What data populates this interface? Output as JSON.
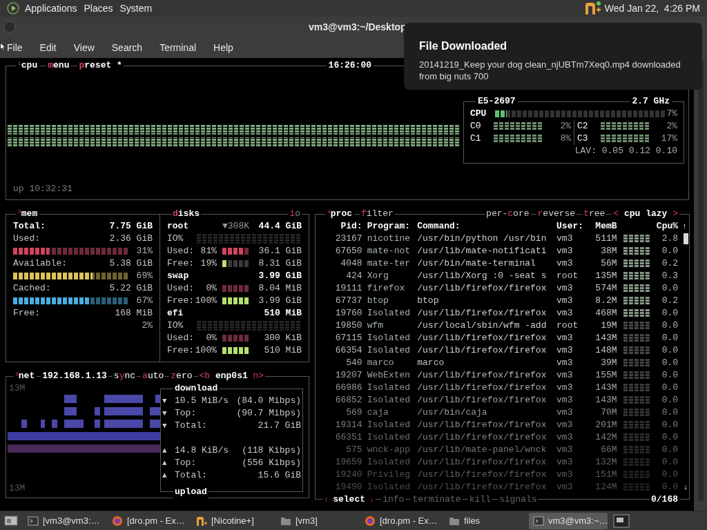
{
  "top_panel": {
    "menus": [
      "Applications",
      "Places",
      "System"
    ],
    "clock": "Wed Jan 22,  4:26 PM"
  },
  "window": {
    "title": "vm3@vm3:~/Desktop",
    "menu": [
      "File",
      "Edit",
      "View",
      "Search",
      "Terminal",
      "Help"
    ]
  },
  "notification": {
    "title": "File Downloaded",
    "body": "20141219_Keep your dog clean_njUBTm7Xeq0.mp4 downloaded from big nuts 700"
  },
  "cpu": {
    "number": "1",
    "title": "cpu",
    "buttons": [
      {
        "key": "m",
        "after": "enu"
      },
      {
        "key": "p",
        "after": "reset *"
      }
    ],
    "clock": "16:26:00",
    "uptime": "up 10:32:31",
    "model": "E5-2697",
    "freq": "2.7 GHz",
    "total": {
      "label": "CPU",
      "level": 0.07,
      "value": "7%"
    },
    "cores": [
      {
        "label": "C0",
        "value": "2%"
      },
      {
        "label": "C2",
        "value": "2%"
      },
      {
        "label": "C1",
        "value": "8%"
      },
      {
        "label": "C3",
        "value": "17%"
      }
    ],
    "load": "LAV: 0.05 0.12 0.10"
  },
  "mem": {
    "number": "2",
    "title": "mem",
    "rows": [
      {
        "kind": "heading",
        "label": "Total:",
        "value": "7.75 GiB"
      },
      {
        "kind": "line",
        "label": "Used:",
        "value": "2.36 GiB"
      },
      {
        "kind": "meter",
        "level": 0.31,
        "value": "31%"
      },
      {
        "kind": "line",
        "label": "Available:",
        "value": "5.38 GiB"
      },
      {
        "kind": "meter",
        "level": 0.69,
        "value": "69%"
      },
      {
        "kind": "line",
        "label": "Cached:",
        "value": "5.22 GiB"
      },
      {
        "kind": "meter",
        "level": 0.67,
        "value": "67%"
      },
      {
        "kind": "line",
        "label": "Free:",
        "value": "168 MiB"
      },
      {
        "kind": "percent",
        "value": "2%"
      }
    ]
  },
  "disks": {
    "title": {
      "key": "d",
      "after": "isks"
    },
    "io_button": {
      "key": "i",
      "after": "o"
    },
    "items": [
      {
        "name": "root",
        "io": "▼308K",
        "size": "44.4 GiB",
        "rows": [
          {
            "kind": "io",
            "label": "IO%"
          },
          {
            "kind": "meter",
            "label": "Used:",
            "pct": "81%",
            "level": 0.81,
            "value": "36.1 GiB"
          },
          {
            "kind": "meter",
            "label": "Free:",
            "pct": "19%",
            "level": 0.19,
            "value": "8.31 GiB"
          }
        ]
      },
      {
        "name": "swap",
        "size": "3.99 GiB",
        "rows": [
          {
            "kind": "meter",
            "label": "Used:",
            "pct": "0%",
            "level": 0,
            "value": "8.04 MiB"
          },
          {
            "kind": "meter",
            "label": "Free:",
            "pct": "100%",
            "level": 1,
            "value": "3.99 GiB"
          }
        ]
      },
      {
        "name": "efi",
        "size": "510 MiB",
        "rows": [
          {
            "kind": "io",
            "label": "IO%"
          },
          {
            "kind": "meter",
            "label": "Used:",
            "pct": "0%",
            "level": 0,
            "value": "300 KiB"
          },
          {
            "kind": "meter",
            "label": "Free:",
            "pct": "100%",
            "level": 1,
            "value": "510 MiB"
          }
        ]
      }
    ]
  },
  "net": {
    "number": "3",
    "title": "net",
    "ip": "192.168.1.13",
    "buttons": [
      {
        "before": "s",
        "key": "y",
        "after": "nc"
      },
      {
        "key": "a",
        "after": "uto"
      },
      {
        "key": "z",
        "after": "ero"
      }
    ],
    "iface": {
      "prev": "<b",
      "name": "enp0s1",
      "next": "n>"
    },
    "scale_top": "13M",
    "scale_bottom": "13M",
    "download": {
      "title": "download",
      "rows": [
        {
          "arrow": "▼",
          "label": "10.5 MiB/s",
          "value": "(84.0 Mibps)"
        },
        {
          "arrow": "▼",
          "label": "Top:",
          "value": "(90.7 Mibps)"
        },
        {
          "arrow": "▼",
          "label": "Total:",
          "value": "21.7 GiB"
        }
      ]
    },
    "upload": {
      "title": "upload",
      "rows": [
        {
          "arrow": "▲",
          "label": "14.8 KiB/s",
          "value": "(118 Kibps)"
        },
        {
          "arrow": "▲",
          "label": "Top:",
          "value": "(556 Kibps)"
        },
        {
          "arrow": "▲",
          "label": "Total:",
          "value": "15.6 GiB"
        }
      ]
    }
  },
  "proc": {
    "number": "4",
    "title": "proc",
    "buttons": [
      {
        "key": "f",
        "after": "ilter"
      },
      {
        "before": "per-",
        "key": "c",
        "after": "ore"
      },
      {
        "key": "r",
        "after": "everse"
      },
      {
        "key": "t",
        "after": "ree"
      }
    ],
    "sort": {
      "prev": "<",
      "label": "cpu lazy",
      "next": ">"
    },
    "columns": [
      "Pid:",
      "Program:",
      "Command:",
      "User:",
      "MemB",
      "Cpu%"
    ],
    "scroll_up": "↑",
    "scroll_down": "↓",
    "rows": [
      {
        "pid": "23167",
        "program": "nicotine",
        "command": "/usr/bin/python /usr/bin",
        "user": "vm3",
        "mem": "511M",
        "cpu": "2.8"
      },
      {
        "pid": "67650",
        "program": "mate-not",
        "command": "/usr/lib/mate-notificati",
        "user": "vm3",
        "mem": "38M",
        "cpu": "0.0"
      },
      {
        "pid": "4048",
        "program": "mate-ter",
        "command": "/usr/bin/mate-terminal",
        "user": "vm3",
        "mem": "56M",
        "cpu": "0.2"
      },
      {
        "pid": "424",
        "program": "Xorg",
        "command": "/usr/lib/Xorg :0 -seat s",
        "user": "root",
        "mem": "135M",
        "cpu": "0.3"
      },
      {
        "pid": "19111",
        "program": "firefox",
        "command": "/usr/lib/firefox/firefox",
        "user": "vm3",
        "mem": "574M",
        "cpu": "0.0"
      },
      {
        "pid": "67737",
        "program": "btop",
        "command": "btop",
        "user": "vm3",
        "mem": "8.2M",
        "cpu": "0.2"
      },
      {
        "pid": "19760",
        "program": "Isolated",
        "command": "/usr/lib/firefox/firefox",
        "user": "vm3",
        "mem": "468M",
        "cpu": "0.0"
      },
      {
        "pid": "19850",
        "program": "wfm",
        "command": "/usr/local/sbin/wfm -add",
        "user": "root",
        "mem": "19M",
        "cpu": "0.0"
      },
      {
        "pid": "67115",
        "program": "Isolated",
        "command": "/usr/lib/firefox/firefox",
        "user": "vm3",
        "mem": "143M",
        "cpu": "0.0"
      },
      {
        "pid": "66354",
        "program": "Isolated",
        "command": "/usr/lib/firefox/firefox",
        "user": "vm3",
        "mem": "148M",
        "cpu": "0.0"
      },
      {
        "pid": "540",
        "program": "marco",
        "command": "marco",
        "user": "vm3",
        "mem": "39M",
        "cpu": "0.0"
      },
      {
        "pid": "19207",
        "program": "WebExten",
        "command": "/usr/lib/firefox/firefox",
        "user": "vm3",
        "mem": "155M",
        "cpu": "0.0"
      },
      {
        "pid": "66986",
        "program": "Isolated",
        "command": "/usr/lib/firefox/firefox",
        "user": "vm3",
        "mem": "143M",
        "cpu": "0.0"
      },
      {
        "pid": "66852",
        "program": "Isolated",
        "command": "/usr/lib/firefox/firefox",
        "user": "vm3",
        "mem": "143M",
        "cpu": "0.0"
      },
      {
        "pid": "569",
        "program": "caja",
        "command": "/usr/bin/caja",
        "user": "vm3",
        "mem": "70M",
        "cpu": "0.0"
      },
      {
        "pid": "19314",
        "program": "Isolated",
        "command": "/usr/lib/firefox/firefox",
        "user": "vm3",
        "mem": "201M",
        "cpu": "0.0"
      },
      {
        "pid": "66351",
        "program": "Isolated",
        "command": "/usr/lib/firefox/firefox",
        "user": "vm3",
        "mem": "142M",
        "cpu": "0.0"
      },
      {
        "pid": "575",
        "program": "wnck-app",
        "command": "/usr/lib/mate-panel/wnck",
        "user": "vm3",
        "mem": "66M",
        "cpu": "0.0"
      },
      {
        "pid": "19659",
        "program": "Isolated",
        "command": "/usr/lib/firefox/firefox",
        "user": "vm3",
        "mem": "132M",
        "cpu": "0.0"
      },
      {
        "pid": "19240",
        "program": "Privileg",
        "command": "/usr/lib/firefox/firefox",
        "user": "vm3",
        "mem": "151M",
        "cpu": "0.0"
      },
      {
        "pid": "19490",
        "program": "Isolated",
        "command": "/usr/lib/firefox/firefox",
        "user": "vm3",
        "mem": "124M",
        "cpu": "0.0"
      }
    ],
    "footer": {
      "up": "↑",
      "select": "select",
      "down": "↓",
      "actions": [
        {
          "label": "info",
          "disabled": true
        },
        {
          "label": "terminate",
          "disabled": true
        },
        {
          "label": "kill",
          "disabled": true
        },
        {
          "label": "signals",
          "disabled": true
        }
      ],
      "count": "0/168"
    }
  },
  "taskbar": {
    "items": [
      {
        "kind": "terminal",
        "label": "[vm3@vm3:…",
        "selected": false
      },
      {
        "kind": "firefox",
        "label": "[dro.pm - Ex…",
        "selected": false
      },
      {
        "kind": "nicotine",
        "label": "[Nicotine+]",
        "selected": false
      },
      {
        "kind": "folder",
        "label": "[vm3]",
        "selected": false
      },
      {
        "kind": "firefox",
        "label": "[dro.pm - Ex…",
        "selected": false
      },
      {
        "kind": "folder",
        "label": "files",
        "selected": false
      },
      {
        "kind": "terminal",
        "label": "vm3@vm3:~…",
        "selected": true
      }
    ]
  }
}
